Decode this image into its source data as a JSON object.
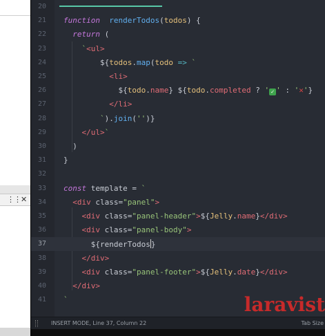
{
  "sidebar": {
    "tab_icons": [
      "⋮",
      "⋮",
      "✕"
    ]
  },
  "editor": {
    "lines": [
      {
        "n": "20"
      },
      {
        "n": "21",
        "t": [
          [
            "kw",
            "function"
          ],
          [
            "",
            "  "
          ],
          [
            "fn",
            "renderTodos"
          ],
          [
            "",
            "("
          ],
          [
            "pn",
            "todos"
          ],
          [
            "",
            ") {"
          ]
        ]
      },
      {
        "n": "22",
        "t": [
          [
            "",
            "  "
          ],
          [
            "kw",
            "return"
          ],
          [
            "",
            " ("
          ]
        ]
      },
      {
        "n": "23",
        "t": [
          [
            "",
            "    "
          ],
          [
            "str",
            "`"
          ],
          [
            "tg",
            "<ul>"
          ]
        ]
      },
      {
        "n": "24",
        "t": [
          [
            "",
            "        "
          ],
          [
            "ip",
            "${"
          ],
          [
            "pn",
            "todos"
          ],
          [
            "",
            "."
          ],
          [
            "fn",
            "map"
          ],
          [
            "",
            "("
          ],
          [
            "pn",
            "todo"
          ],
          [
            "",
            " "
          ],
          [
            "op",
            "=>"
          ],
          [
            "",
            " "
          ],
          [
            "str",
            "`"
          ]
        ]
      },
      {
        "n": "25",
        "t": [
          [
            "",
            "          "
          ],
          [
            "tg",
            "<li>"
          ]
        ]
      },
      {
        "n": "26",
        "t": [
          [
            "",
            "            "
          ],
          [
            "ip",
            "${"
          ],
          [
            "pn",
            "todo"
          ],
          [
            "",
            "."
          ],
          [
            "pr",
            "name"
          ],
          [
            "ip",
            "}"
          ],
          [
            "",
            " "
          ],
          [
            "ip",
            "${"
          ],
          [
            "pn",
            "todo"
          ],
          [
            "",
            "."
          ],
          [
            "pr",
            "completed"
          ],
          [
            "",
            " ? "
          ],
          [
            "str",
            "'"
          ],
          [
            "check",
            "✓"
          ],
          [
            "str",
            "'"
          ],
          [
            "",
            " : "
          ],
          [
            "str",
            "'"
          ],
          [
            "cross",
            "✕"
          ],
          [
            "str",
            "'"
          ],
          [
            "ip",
            "}"
          ]
        ]
      },
      {
        "n": "27",
        "t": [
          [
            "",
            "          "
          ],
          [
            "tg",
            "</li>"
          ]
        ]
      },
      {
        "n": "28",
        "t": [
          [
            "",
            "        "
          ],
          [
            "str",
            "`"
          ],
          [
            "",
            ")."
          ],
          [
            "fn",
            "join"
          ],
          [
            "",
            "("
          ],
          [
            "str",
            "''"
          ],
          [
            "",
            ")"
          ],
          [
            "ip",
            "}"
          ]
        ]
      },
      {
        "n": "29",
        "t": [
          [
            "",
            "    "
          ],
          [
            "tg",
            "</ul>"
          ],
          [
            "str",
            "`"
          ]
        ]
      },
      {
        "n": "30",
        "t": [
          [
            "",
            "  )"
          ]
        ]
      },
      {
        "n": "31",
        "t": [
          [
            "",
            "}"
          ]
        ]
      },
      {
        "n": "32"
      },
      {
        "n": "33",
        "t": [
          [
            "kw",
            "const"
          ],
          [
            "",
            " template = "
          ],
          [
            "str",
            "`"
          ]
        ]
      },
      {
        "n": "34",
        "t": [
          [
            "",
            "  "
          ],
          [
            "tg",
            "<div"
          ],
          [
            "",
            " class="
          ],
          [
            "str",
            "\"panel\""
          ],
          [
            "tg",
            ">"
          ]
        ]
      },
      {
        "n": "35",
        "t": [
          [
            "",
            "    "
          ],
          [
            "tg",
            "<div"
          ],
          [
            "",
            " class="
          ],
          [
            "str",
            "\"panel-header\""
          ],
          [
            "tg",
            ">"
          ],
          [
            "ip",
            "${"
          ],
          [
            "pn",
            "Jelly"
          ],
          [
            "",
            "."
          ],
          [
            "pr",
            "name"
          ],
          [
            "ip",
            "}"
          ],
          [
            "tg",
            "</div>"
          ]
        ]
      },
      {
        "n": "36",
        "t": [
          [
            "",
            "    "
          ],
          [
            "tg",
            "<div"
          ],
          [
            "",
            " class="
          ],
          [
            "str",
            "\"panel-body\""
          ],
          [
            "tg",
            ">"
          ]
        ]
      },
      {
        "n": "37",
        "active": true,
        "t": [
          [
            "",
            "      "
          ],
          [
            "ip",
            "${"
          ],
          [
            "",
            "renderTodos"
          ],
          [
            "cursor",
            ""
          ],
          [
            "ip",
            "}"
          ]
        ]
      },
      {
        "n": "38",
        "t": [
          [
            "",
            "    "
          ],
          [
            "tg",
            "</div>"
          ]
        ]
      },
      {
        "n": "39",
        "t": [
          [
            "",
            "    "
          ],
          [
            "tg",
            "<div"
          ],
          [
            "",
            " class="
          ],
          [
            "str",
            "\"panel-footer\""
          ],
          [
            "tg",
            ">"
          ],
          [
            "ip",
            "${"
          ],
          [
            "pn",
            "Jelly"
          ],
          [
            "",
            "."
          ],
          [
            "pr",
            "date"
          ],
          [
            "ip",
            "}"
          ],
          [
            "tg",
            "</div>"
          ]
        ]
      },
      {
        "n": "40",
        "t": [
          [
            "",
            "  "
          ],
          [
            "tg",
            "</div>"
          ]
        ]
      },
      {
        "n": "41",
        "t": [
          [
            "str",
            "`"
          ]
        ]
      }
    ]
  },
  "statusbar": {
    "status": "INSERT MODE, Line 37, Column 22",
    "right": "Tab Size"
  },
  "watermark": "laravist",
  "colors": {
    "editor_bg": "#282c34",
    "keyword": "#c678dd",
    "function": "#61afef",
    "param": "#e5c07b",
    "string": "#98c379",
    "tag": "#e06c75",
    "watermark": "#c72a2a"
  }
}
